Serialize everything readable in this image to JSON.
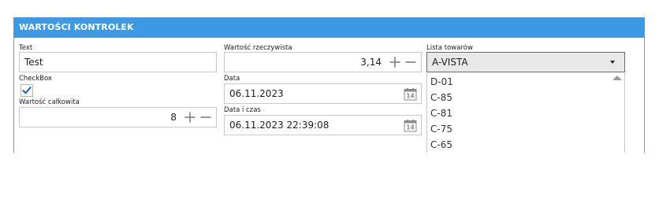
{
  "panel": {
    "title": "WARTOŚCI KONTROLEK"
  },
  "text_field": {
    "label": "Text",
    "value": "Test"
  },
  "checkbox": {
    "label": "CheckBox",
    "checked": true
  },
  "total_value": {
    "label": "Wartość całkowita",
    "value": "8"
  },
  "real_value": {
    "label": "Wartość rzeczywista",
    "value": "3,14"
  },
  "date": {
    "label": "Data",
    "value": "06.11.2023",
    "calendar_badge": "14"
  },
  "datetime": {
    "label": "Data i czas",
    "value": "06.11.2023 22:39:08",
    "calendar_badge": "14"
  },
  "goods": {
    "label": "Lista towarów",
    "selected": "A-VISTA",
    "options": [
      "D-01",
      "C-85",
      "C-81",
      "C-75",
      "C-65"
    ]
  },
  "colors": {
    "header": "#3d99e3",
    "check": "#1f6fc2",
    "icon": "#8a8a8a"
  }
}
